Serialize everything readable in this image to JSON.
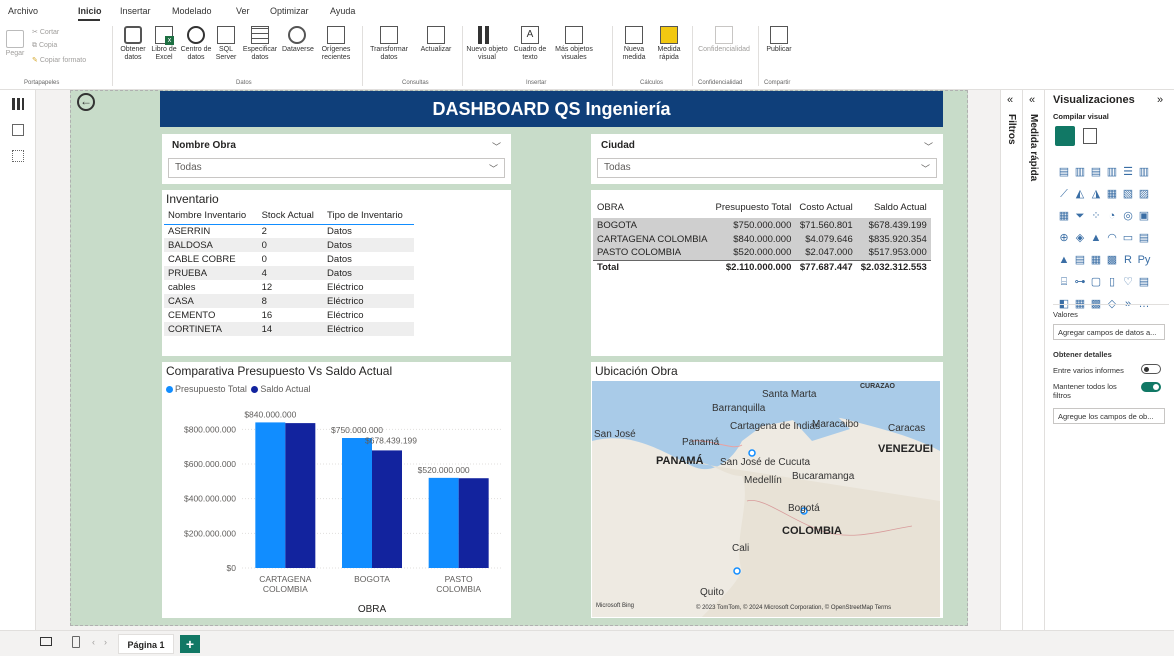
{
  "menu": [
    "Archivo",
    "Inicio",
    "Insertar",
    "Modelado",
    "Ver",
    "Optimizar",
    "Ayuda"
  ],
  "ribbon": {
    "clipboard": {
      "paste": "Pegar",
      "cut": "Cortar",
      "copy": "Copia",
      "format": "Copiar formato",
      "group": "Portapapeles"
    },
    "data_buttons": [
      "Obtener datos",
      "Libro de Excel",
      "Centro de datos",
      "SQL Server",
      "Especificar datos",
      "Dataverse",
      "Orígenes recientes"
    ],
    "data_group": "Datos",
    "queries_buttons": [
      "Transformar datos",
      "Actualizar"
    ],
    "queries_group": "Consultas",
    "insert_buttons": [
      "Nuevo objeto visual",
      "Cuadro de texto",
      "Más objetos visuales"
    ],
    "insert_group": "Insertar",
    "calc_buttons": [
      "Nueva medida",
      "Medida rápida"
    ],
    "calc_group": "Cálculos",
    "sens_button": "Confidencialidad",
    "sens_group": "Confidencialidad",
    "share_button": "Publicar",
    "share_group": "Compartir"
  },
  "dashboard_title": "DASHBOARD QS Ingeniería",
  "slicer_obra": {
    "label": "Nombre Obra",
    "value": "Todas"
  },
  "slicer_ciudad": {
    "label": "Ciudad",
    "value": "Todas"
  },
  "inventario": {
    "title": "Inventario",
    "columns": [
      "Nombre Inventario",
      "Stock Actual",
      "Tipo de Inventario"
    ],
    "rows": [
      [
        "ASERRIN",
        "2",
        "Datos"
      ],
      [
        "BALDOSA",
        "0",
        "Datos"
      ],
      [
        "CABLE COBRE",
        "0",
        "Datos"
      ],
      [
        "PRUEBA",
        "4",
        "Datos"
      ],
      [
        "cables",
        "12",
        "Eléctrico"
      ],
      [
        "CASA",
        "8",
        "Eléctrico"
      ],
      [
        "CEMENTO",
        "16",
        "Eléctrico"
      ],
      [
        "CORTINETA",
        "14",
        "Eléctrico"
      ]
    ]
  },
  "obra_table": {
    "columns": [
      "OBRA",
      "Presupuesto Total",
      "Costo Actual",
      "Saldo Actual"
    ],
    "rows": [
      [
        "BOGOTA",
        "$750.000.000",
        "$71.560.801",
        "$678.439.199"
      ],
      [
        "CARTAGENA COLOMBIA",
        "$840.000.000",
        "$4.079.646",
        "$835.920.354"
      ],
      [
        "PASTO COLOMBIA",
        "$520.000.000",
        "$2.047.000",
        "$517.953.000"
      ]
    ],
    "total": [
      "Total",
      "$2.110.000.000",
      "$77.687.447",
      "$2.032.312.553"
    ]
  },
  "chart_data": {
    "type": "bar",
    "title": "Comparativa Presupuesto Vs Saldo Actual",
    "xlabel": "OBRA",
    "ylabel": "",
    "categories": [
      "CARTAGENA COLOMBIA",
      "BOGOTA",
      "PASTO COLOMBIA"
    ],
    "series": [
      {
        "name": "Presupuesto Total",
        "color": "#118dff",
        "values": [
          840000000,
          750000000,
          520000000
        ],
        "labels": [
          "$840.000.000",
          "$750.000.000",
          "$520.000.000"
        ]
      },
      {
        "name": "Saldo Actual",
        "color": "#12239e",
        "values": [
          835920354,
          678439199,
          517953000
        ],
        "labels": [
          "",
          "$678.439.199",
          ""
        ]
      }
    ],
    "yticks": [
      "$0",
      "$200.000.000",
      "$400.000.000",
      "$600.000.000",
      "$800.000.000"
    ],
    "ylim": [
      0,
      900000000
    ],
    "grid": true,
    "legend": "top-left"
  },
  "map": {
    "title": "Ubicación Obra",
    "labels": [
      "Santa Marta",
      "CURAZAO",
      "Barranquilla",
      "Cartagena de Indias",
      "Maracaibo",
      "Caracas",
      "San José",
      "Panamá",
      "PANAMÁ",
      "VENEZUEI",
      "San José de Cucuta",
      "Bucaramanga",
      "Medellín",
      "Bogotá",
      "COLOMBIA",
      "Cali",
      "Quito"
    ],
    "attribution": "© 2023 TomTom, © 2024 Microsoft Corporation, © OpenStreetMap  Terms",
    "provider": "Microsoft Bing"
  },
  "panes": {
    "filters": "Filtros",
    "medida": "Medida rápida",
    "viz_title": "Visualizaciones",
    "build_visual": "Compilar visual",
    "values_label": "Valores",
    "values_placeholder": "Agregar campos de datos a...",
    "drill_label": "Obtener detalles",
    "cross_report": "Entre varios informes",
    "keep_filters": "Mantener todos los filtros",
    "drill_placeholder": "Agregue los campos de ob..."
  },
  "page_tab": "Página 1",
  "colors": {
    "title_bar": "#0f3f7a",
    "series1": "#118dff",
    "series2": "#12239e",
    "canvas": "#c8dcc9"
  }
}
